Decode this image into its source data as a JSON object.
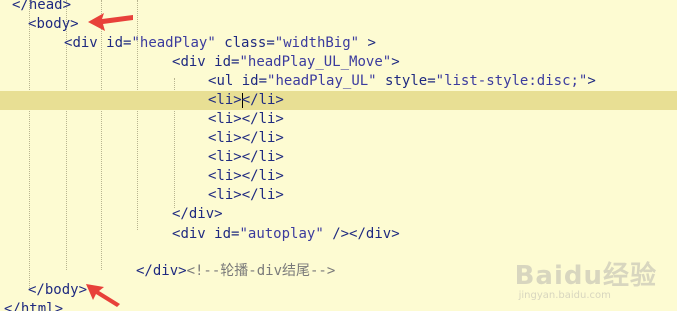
{
  "code_lines": {
    "l0": {
      "indent": "  ",
      "open": "</",
      "name": "head",
      "close": ">"
    },
    "l1": {
      "indent": "  ",
      "open": "<",
      "name": "body",
      "close": ">"
    },
    "l2": {
      "indent": "      ",
      "open": "<",
      "name": "div",
      "a1": "id",
      "v1": "\"headPlay\"",
      "a2": "class",
      "v2": "\"widthBig\"",
      "close": " >"
    },
    "l3": {
      "indent": "              ",
      "open": "<",
      "name": "div",
      "a1": "id",
      "v1": "\"headPlay_UL_Move\"",
      "close": ">"
    },
    "l4": {
      "indent": "                  ",
      "open": "<",
      "name": "ul",
      "a1": "id",
      "v1": "\"headPlay_UL\"",
      "a2": "style",
      "v2": "\"list-style:disc;\"",
      "close": ">"
    },
    "l5": {
      "indent": "                  ",
      "text": "<li>",
      "text2": "</li>"
    },
    "l6": {
      "indent": "                  ",
      "text": "<li></li>"
    },
    "l7": {
      "indent": "                  ",
      "text": "<li></li>"
    },
    "l8": {
      "indent": "                  ",
      "text": "<li></li>"
    },
    "l9": {
      "indent": "                  ",
      "text": "<li></li>"
    },
    "l10": {
      "indent": "                  ",
      "text": "<li></li>"
    },
    "l11": {
      "indent": "              ",
      "text": "</div>"
    },
    "l12": {
      "indent": "              ",
      "open": "<",
      "name": "div",
      "a1": "id",
      "v1": "\"autoplay\"",
      "close": " /></div>"
    },
    "l13": {
      "text": ""
    },
    "l14": {
      "indent": "            ",
      "text": "</div>",
      "comment": "<!--轮播-div结尾-->"
    },
    "l15": {
      "indent": "  ",
      "text": "</body>"
    },
    "l16": {
      "indent": "",
      "text": "</html>"
    }
  },
  "watermark": {
    "logo": "Baidu经验",
    "url": "jingyan.baidu.com"
  },
  "colors": {
    "background": "#fdfbd2",
    "active_line": "#e8df94",
    "arrow": "#e8413a"
  }
}
